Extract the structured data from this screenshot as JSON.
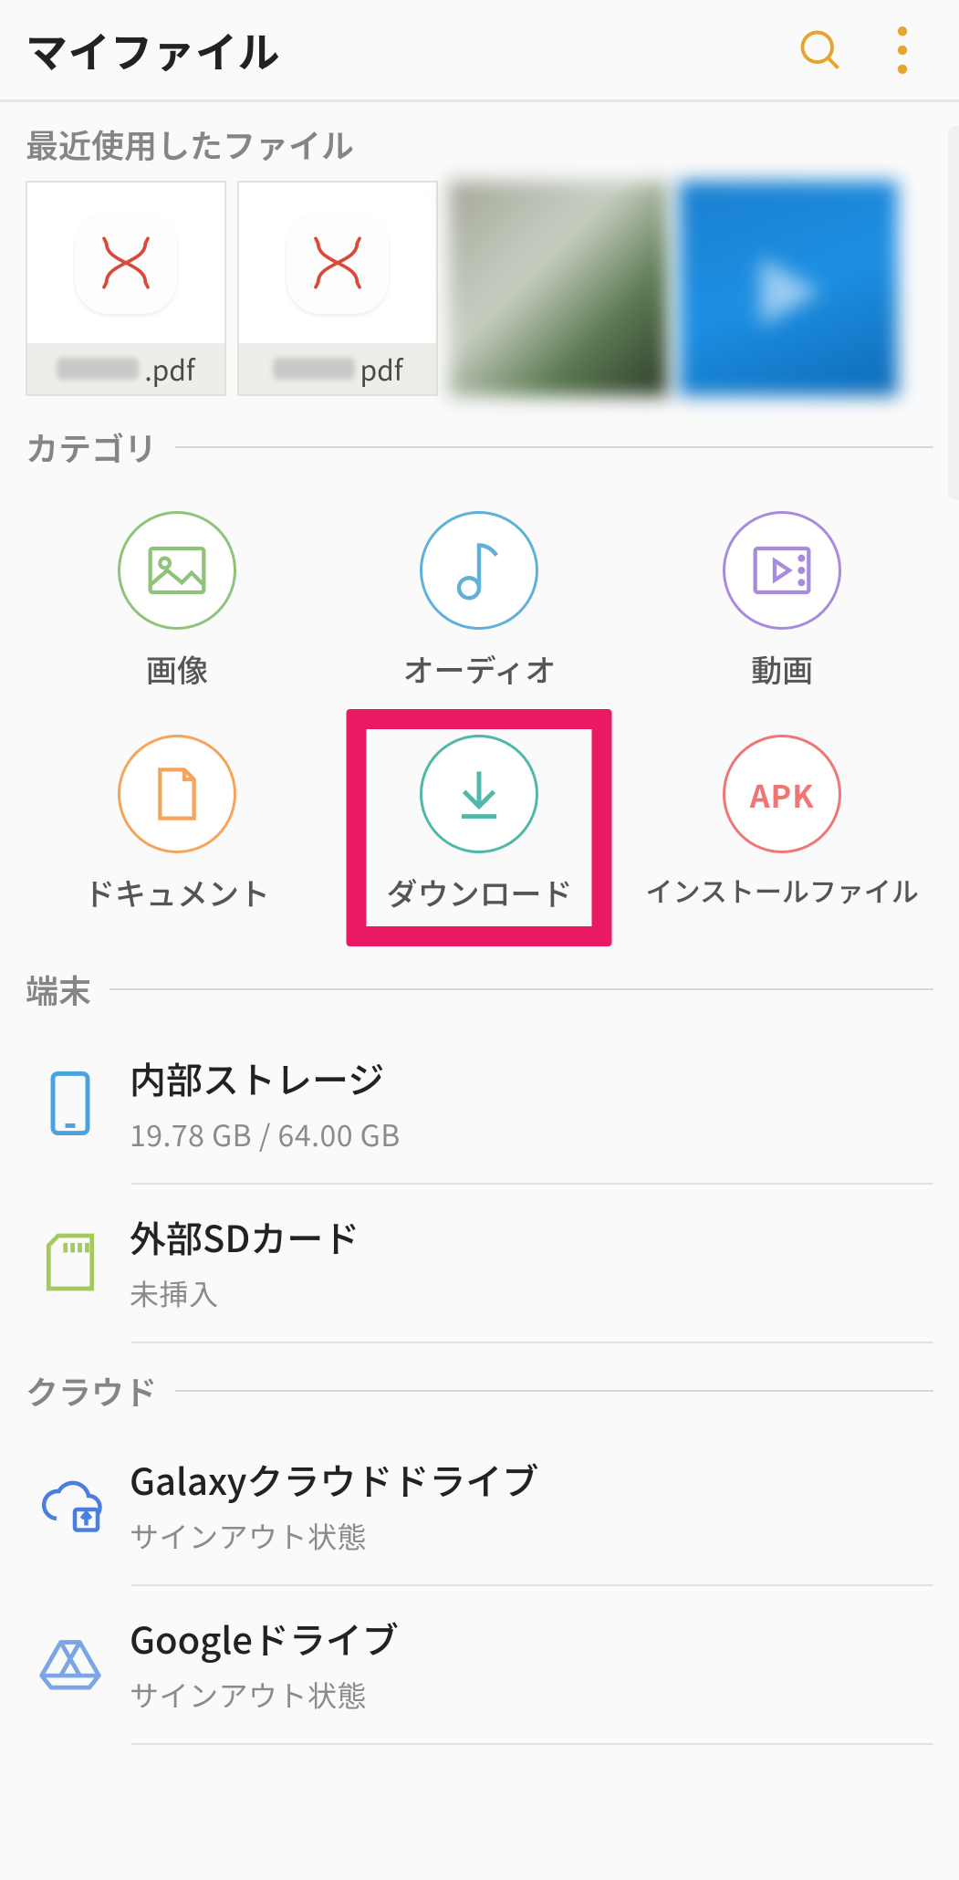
{
  "header": {
    "title": "マイファイル"
  },
  "recent": {
    "section_title": "最近使用したファイル",
    "files": [
      {
        "ext": ".pdf"
      },
      {
        "ext": "pdf"
      }
    ]
  },
  "categories": {
    "section_title": "カテゴリ",
    "items": [
      {
        "label": "画像"
      },
      {
        "label": "オーディオ"
      },
      {
        "label": "動画"
      },
      {
        "label": "ドキュメント"
      },
      {
        "label": "ダウンロード",
        "highlighted": true
      },
      {
        "label": "インストールファイル",
        "apk_text": "APK"
      }
    ]
  },
  "device": {
    "section_title": "端末",
    "items": [
      {
        "title": "内部ストレージ",
        "sub": "19.78 GB / 64.00 GB"
      },
      {
        "title": "外部SDカード",
        "sub": "未挿入"
      }
    ]
  },
  "cloud": {
    "section_title": "クラウド",
    "items": [
      {
        "title": "Galaxyクラウドドライブ",
        "sub": "サインアウト状態"
      },
      {
        "title": "Googleドライブ",
        "sub": "サインアウト状態"
      }
    ]
  },
  "colors": {
    "accent_highlight": "#e91a63",
    "icon_orange": "#e6a431",
    "image_green": "#8fc37a",
    "audio_blue": "#5fb1d8",
    "video_purple": "#a78bdc",
    "doc_orange": "#f5a45a",
    "download_teal": "#4fb8a8",
    "apk_red": "#f07575",
    "storage_blue": "#4aa3e0",
    "sd_green": "#a3c95f",
    "cloud_blue": "#4a7fe0",
    "drive_outline": "#7aa5e6"
  }
}
